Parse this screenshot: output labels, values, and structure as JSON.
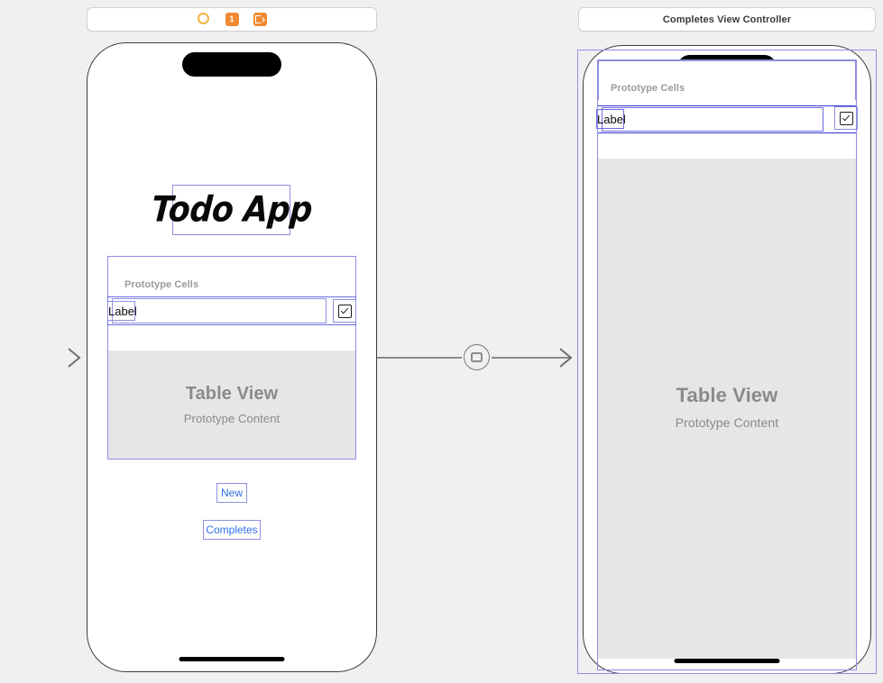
{
  "canvas": {
    "background_color": "#f0f0f0",
    "accent_constraint_color": "#8f8fe0",
    "selection_color": "#3434cf",
    "dock_icon_color": "#ef8b33"
  },
  "left_scene": {
    "dock": {
      "view_controller_icon": "view-controller-circle-icon",
      "first_responder_icon": "first-responder-icon",
      "first_responder_label": "1",
      "exit_icon": "exit-icon"
    },
    "app_title": "Todo App",
    "table_view": {
      "prototype_cells_label": "Prototype Cells",
      "cell_label": "Label",
      "cell_checkbox_icon": "checkbox-checked-icon",
      "placeholder_title": "Table View",
      "placeholder_subtitle": "Prototype Content"
    },
    "buttons": [
      {
        "label": "New"
      },
      {
        "label": "Completes"
      }
    ]
  },
  "right_scene": {
    "title": "Completes View Controller",
    "table_view": {
      "prototype_cells_label": "Prototype Cells",
      "cell_label": "Label",
      "cell_checkbox_icon": "checkbox-checked-icon",
      "placeholder_title": "Table View",
      "placeholder_subtitle": "Prototype Content"
    }
  },
  "connections": {
    "entry_point_icon": "entry-point-arrow-icon",
    "segue_icon": "present-modally-segue-icon"
  }
}
